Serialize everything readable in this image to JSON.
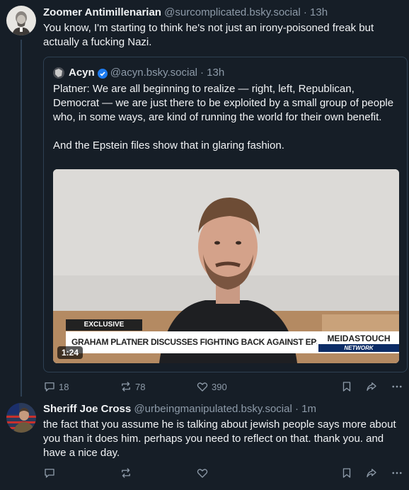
{
  "posts": [
    {
      "author": "Zoomer Antimillenarian",
      "handle": "@surcomplicated.bsky.social",
      "time": "· 13h",
      "text": "You know, I'm starting to think he's not just an irony-poisoned freak but actually a fucking Nazi.",
      "quote": {
        "author": "Acyn",
        "verified_icon": "verified-check-icon",
        "handle": "@acyn.bsky.social",
        "time": "· 13h",
        "paragraphs": [
          "Platner: We are all beginning to realize — right, left, Republican, Democrat — we are just there to be exploited by a small group of people who, in some ways, are kind of running the world for their own benefit.",
          "And the Epstein files show that in glaring fashion."
        ],
        "video": {
          "duration": "1:24",
          "tag": "EXCLUSIVE",
          "headline": "GRAHAM PLATNER DISCUSSES FIGHTING BACK AGAINST EPSTEIN CLASS",
          "brand": "MEIDASTOUCH",
          "brand_sub": "NETWORK"
        }
      },
      "actions": {
        "replies": "18",
        "reposts": "78",
        "likes": "390"
      }
    },
    {
      "author": "Sheriff Joe Cross",
      "handle": "@urbeingmanipulated.bsky.social",
      "time": "· 1m",
      "text": "the fact that you assume he is talking about jewish people says more about you than it does him. perhaps you need to reflect on that. thank you. and have a nice day.",
      "actions": {
        "replies": "",
        "reposts": "",
        "likes": ""
      }
    }
  ],
  "colors": {
    "background": "#161e27",
    "muted": "#8d9aa8",
    "border": "#2e4052",
    "verified": "#1d7bf0"
  }
}
